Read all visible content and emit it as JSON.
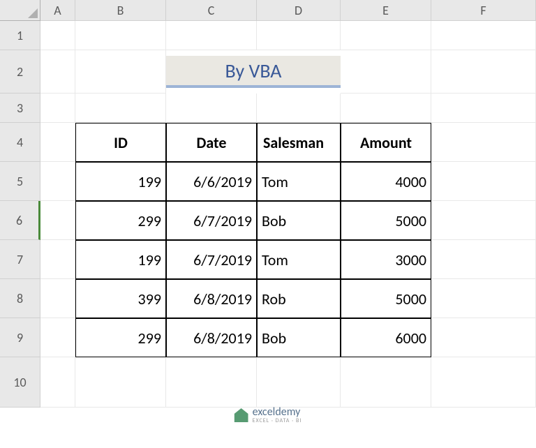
{
  "columns": [
    "A",
    "B",
    "C",
    "D",
    "E",
    "F"
  ],
  "rows": [
    "1",
    "2",
    "3",
    "4",
    "5",
    "6",
    "7",
    "8",
    "9",
    "10"
  ],
  "title": "By VBA",
  "table": {
    "headers": [
      "ID",
      "Date",
      "Salesman",
      "Amount"
    ],
    "data": [
      {
        "id": "199",
        "date": "6/6/2019",
        "salesman": "Tom",
        "amount": "4000"
      },
      {
        "id": "299",
        "date": "6/7/2019",
        "salesman": "Bob",
        "amount": "5000"
      },
      {
        "id": "199",
        "date": "6/7/2019",
        "salesman": "Tom",
        "amount": "3000"
      },
      {
        "id": "399",
        "date": "6/8/2019",
        "salesman": "Rob",
        "amount": "5000"
      },
      {
        "id": "299",
        "date": "6/8/2019",
        "salesman": "Bob",
        "amount": "6000"
      }
    ]
  },
  "watermark": {
    "main": "exceldemy",
    "sub": "EXCEL · DATA · BI"
  },
  "selected_row": "6"
}
